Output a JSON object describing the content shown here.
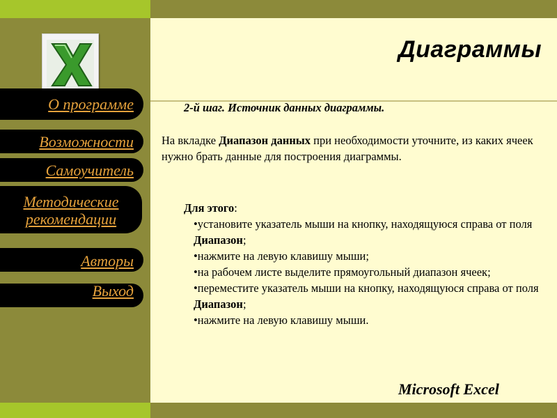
{
  "sidebar": {
    "nav": [
      {
        "label": "О программе"
      },
      {
        "label": "Возможности"
      },
      {
        "label": "Самоучитель"
      },
      {
        "label_line1": "Методические",
        "label_line2": "рекомендации"
      },
      {
        "label": "Авторы"
      },
      {
        "label": "Выход"
      }
    ]
  },
  "main": {
    "title": "Диаграммы",
    "step": "2-й шаг. Источник данных диаграммы.",
    "para": {
      "pre": "На вкладке ",
      "bold": "Диапазон данных",
      "post": " при необходимости уточните, из каких ячеек нужно брать данные для построения диаграммы."
    },
    "for_this": {
      "bold": "Для этого",
      "colon": ":"
    },
    "bullets": [
      {
        "pre": "•установите указатель мыши на кнопку, находящуюся справа от поля ",
        "bold": "Диапазон",
        "post": ";"
      },
      {
        "pre": "•нажмите на левую клавишу мыши;",
        "bold": "",
        "post": ""
      },
      {
        "pre": "•на рабочем листе выделите прямоугольный диапазон ячеек;",
        "bold": "",
        "post": ""
      },
      {
        "pre": "•переместите указатель мыши на кнопку, находящуюся справа от поля ",
        "bold": "Диапазон",
        "post": ";"
      },
      {
        "pre": "•нажмите на левую клавишу мыши.",
        "bold": "",
        "post": ""
      }
    ]
  },
  "footer": {
    "brand": "Microsoft Excel"
  },
  "colors": {
    "accent_green": "#a6c62b",
    "olive": "#8c8a3a",
    "content_bg": "#fffcd0",
    "nav_text": "#e6a23c"
  },
  "icons": {
    "logo": "excel-logo-icon"
  }
}
